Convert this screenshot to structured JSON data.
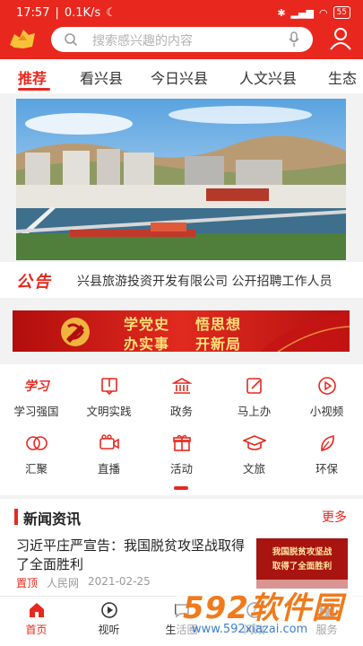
{
  "status_bar": {
    "time": "17:57",
    "speed": "0.1K/s",
    "battery": "55"
  },
  "search": {
    "placeholder": "搜索感兴趣的内容"
  },
  "tabs": [
    {
      "label": "推荐",
      "active": true
    },
    {
      "label": "看兴县"
    },
    {
      "label": "今日兴县"
    },
    {
      "label": "人文兴县"
    },
    {
      "label": "生态"
    }
  ],
  "announcement": {
    "label": "公告",
    "text": "兴县旅游投资开发有限公司 公开招聘工作人员"
  },
  "promo": {
    "slogan_1": "学党史",
    "slogan_2": "悟思想",
    "slogan_3": "办实事",
    "slogan_4": "开新局"
  },
  "services": [
    {
      "label": "学习强国",
      "icon": "xuexi-icon"
    },
    {
      "label": "文明实践",
      "icon": "book-icon"
    },
    {
      "label": "政务",
      "icon": "government-icon"
    },
    {
      "label": "马上办",
      "icon": "edit-icon"
    },
    {
      "label": "小视频",
      "icon": "play-icon"
    },
    {
      "label": "汇聚",
      "icon": "rings-icon"
    },
    {
      "label": "直播",
      "icon": "camera-icon"
    },
    {
      "label": "活动",
      "icon": "gift-icon"
    },
    {
      "label": "文旅",
      "icon": "graduation-cap-icon"
    },
    {
      "label": "环保",
      "icon": "leaf-icon"
    }
  ],
  "news": {
    "section_title": "新闻资讯",
    "more": "更多",
    "headline": "习近平庄严宣告：我国脱贫攻坚战取得了全面胜利",
    "pin": "置顶",
    "source": "人民网",
    "date": "2021-02-25",
    "thumb_line_1": "我国脱贫攻坚战",
    "thumb_line_2": "取得了全面胜利"
  },
  "bottom_nav": [
    {
      "label": "首页",
      "active": true,
      "icon": "home-icon"
    },
    {
      "label": "视听",
      "icon": "play-circle-icon"
    },
    {
      "label": "生活圈",
      "icon": "chat-icon"
    },
    {
      "label": "问政",
      "icon": "question-icon"
    },
    {
      "label": "服务",
      "icon": "grid-icon"
    }
  ],
  "watermark": {
    "brand": "592软件园",
    "url": "www.592xiazai.com"
  },
  "colors": {
    "accent": "#e8281e",
    "background": "#f2f2f2"
  }
}
